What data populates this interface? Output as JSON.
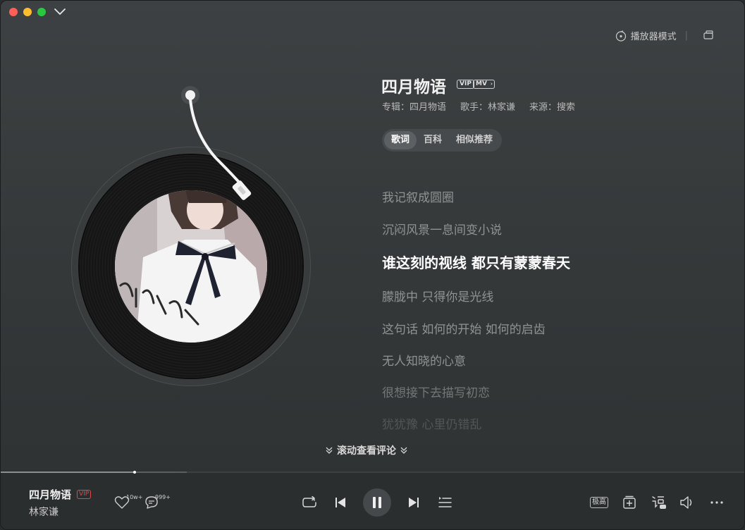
{
  "window": {
    "player_mode_label": "播放器模式"
  },
  "song": {
    "title": "四月物语",
    "badges": [
      "VIP",
      "MV"
    ],
    "meta": {
      "album": "专辑：四月物语",
      "artist": "歌手：林家谦",
      "source": "来源：搜索"
    }
  },
  "tabs": [
    {
      "label": "歌词",
      "active": true
    },
    {
      "label": "百科",
      "active": false
    },
    {
      "label": "相似推荐",
      "active": false
    }
  ],
  "lyrics": {
    "lines": [
      "我记叙成圆圈",
      "沉闷风景一息间变小说",
      "谁这刻的视线 都只有蒙蒙春天",
      "朦胧中 只得你是光线",
      "这句话 如何的开始 如何的启齿",
      "无人知晓的心意",
      "很想接下去描写初恋",
      "犹犹豫 心里仍错乱"
    ],
    "current_index": 2
  },
  "comments_link": "滚动查看评论",
  "now_playing": {
    "title": "四月物语",
    "vip": "VIP",
    "artist": "林家谦",
    "like_count": "10w+",
    "comment_count": "999+",
    "quality": "极高",
    "progress": 0.18
  },
  "colors": {
    "vip_red": "#e04848",
    "current_lyric": "#ffffff",
    "dim_lyric": "#8f9394"
  }
}
